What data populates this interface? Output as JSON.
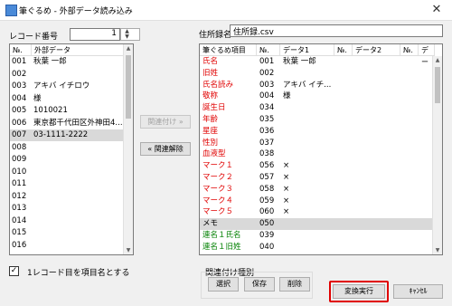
{
  "window": {
    "title": "筆ぐるめ - 外部データ読み込み",
    "close_glyph": "✕"
  },
  "left": {
    "record_label": "レコード番号",
    "record_value": "1",
    "col_no": "№.",
    "col_data": "外部データ",
    "rows": [
      {
        "no": "001",
        "val": "秋葉 一郎"
      },
      {
        "no": "002",
        "val": ""
      },
      {
        "no": "003",
        "val": "アキバ イチロウ"
      },
      {
        "no": "004",
        "val": "様"
      },
      {
        "no": "005",
        "val": "1010021"
      },
      {
        "no": "006",
        "val": "東京都千代田区外神田4..."
      },
      {
        "no": "007",
        "val": "03-1111-2222"
      },
      {
        "no": "008",
        "val": ""
      },
      {
        "no": "009",
        "val": ""
      },
      {
        "no": "010",
        "val": ""
      },
      {
        "no": "011",
        "val": ""
      },
      {
        "no": "012",
        "val": ""
      },
      {
        "no": "013",
        "val": ""
      },
      {
        "no": "014",
        "val": ""
      },
      {
        "no": "015",
        "val": ""
      },
      {
        "no": "016",
        "val": ""
      }
    ]
  },
  "middle": {
    "link_button": "関連付け »",
    "unlink_button": "« 関連解除"
  },
  "right": {
    "file_label": "住所録名",
    "file_value": "住所録.csv",
    "col_item": "筆ぐるめ項目",
    "col_no": "№.",
    "col_data1": "データ1",
    "col_no2": "№.",
    "col_data2": "データ2",
    "col_no3": "№.",
    "col_data3": "デー",
    "rows": [
      {
        "item": "氏名",
        "no": "001",
        "d1": "秋葉 一郎",
        "color": "red"
      },
      {
        "item": "旧姓",
        "no": "002",
        "d1": "",
        "color": "red"
      },
      {
        "item": "氏名読み",
        "no": "003",
        "d1": "アキバ イチ...",
        "color": "red"
      },
      {
        "item": "敬称",
        "no": "004",
        "d1": "様",
        "color": "red"
      },
      {
        "item": "誕生日",
        "no": "034",
        "d1": "",
        "color": "red"
      },
      {
        "item": "年齢",
        "no": "035",
        "d1": "",
        "color": "red"
      },
      {
        "item": "星座",
        "no": "036",
        "d1": "",
        "color": "red"
      },
      {
        "item": "性別",
        "no": "037",
        "d1": "",
        "color": "red"
      },
      {
        "item": "血液型",
        "no": "038",
        "d1": "",
        "color": "red"
      },
      {
        "item": "マーク１",
        "no": "056",
        "d1": "×",
        "color": "red"
      },
      {
        "item": "マーク２",
        "no": "057",
        "d1": "×",
        "color": "red"
      },
      {
        "item": "マーク３",
        "no": "058",
        "d1": "×",
        "color": "red"
      },
      {
        "item": "マーク４",
        "no": "059",
        "d1": "×",
        "color": "red"
      },
      {
        "item": "マーク５",
        "no": "060",
        "d1": "×",
        "color": "red"
      },
      {
        "item": "メモ",
        "no": "050",
        "d1": "",
        "color": "black"
      },
      {
        "item": "連名１氏名",
        "no": "039",
        "d1": "",
        "color": "green"
      },
      {
        "item": "連名１旧姓",
        "no": "040",
        "d1": "",
        "color": "green"
      }
    ]
  },
  "bottom": {
    "checkbox_label": "1レコード目を項目名とする",
    "checkbox_checked": true,
    "group_label": "関連付け種別",
    "select_button": "選択",
    "save_button": "保存",
    "delete_button": "削除",
    "convert_button": "変換実行",
    "cancel_button": "ｷｬﾝｾﾙ"
  },
  "colors": {
    "red": "#e00000",
    "green": "#008000",
    "highlight": "#e00000"
  }
}
